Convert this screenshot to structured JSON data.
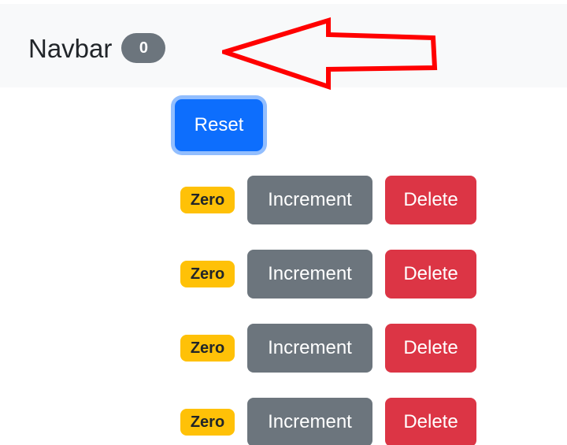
{
  "navbar": {
    "brand": "Navbar",
    "total_count": "0"
  },
  "annotation": {
    "icon": "red-arrow-icon",
    "color": "#ff0000"
  },
  "reset_label": "Reset",
  "counters": [
    {
      "badge": "Zero",
      "increment_label": "Increment",
      "delete_label": "Delete"
    },
    {
      "badge": "Zero",
      "increment_label": "Increment",
      "delete_label": "Delete"
    },
    {
      "badge": "Zero",
      "increment_label": "Increment",
      "delete_label": "Delete"
    },
    {
      "badge": "Zero",
      "increment_label": "Increment",
      "delete_label": "Delete"
    }
  ],
  "colors": {
    "navbar_bg": "#f8f9fa",
    "primary": "#0d6efd",
    "secondary": "#6c757d",
    "warning": "#ffc107",
    "danger": "#dc3545"
  }
}
